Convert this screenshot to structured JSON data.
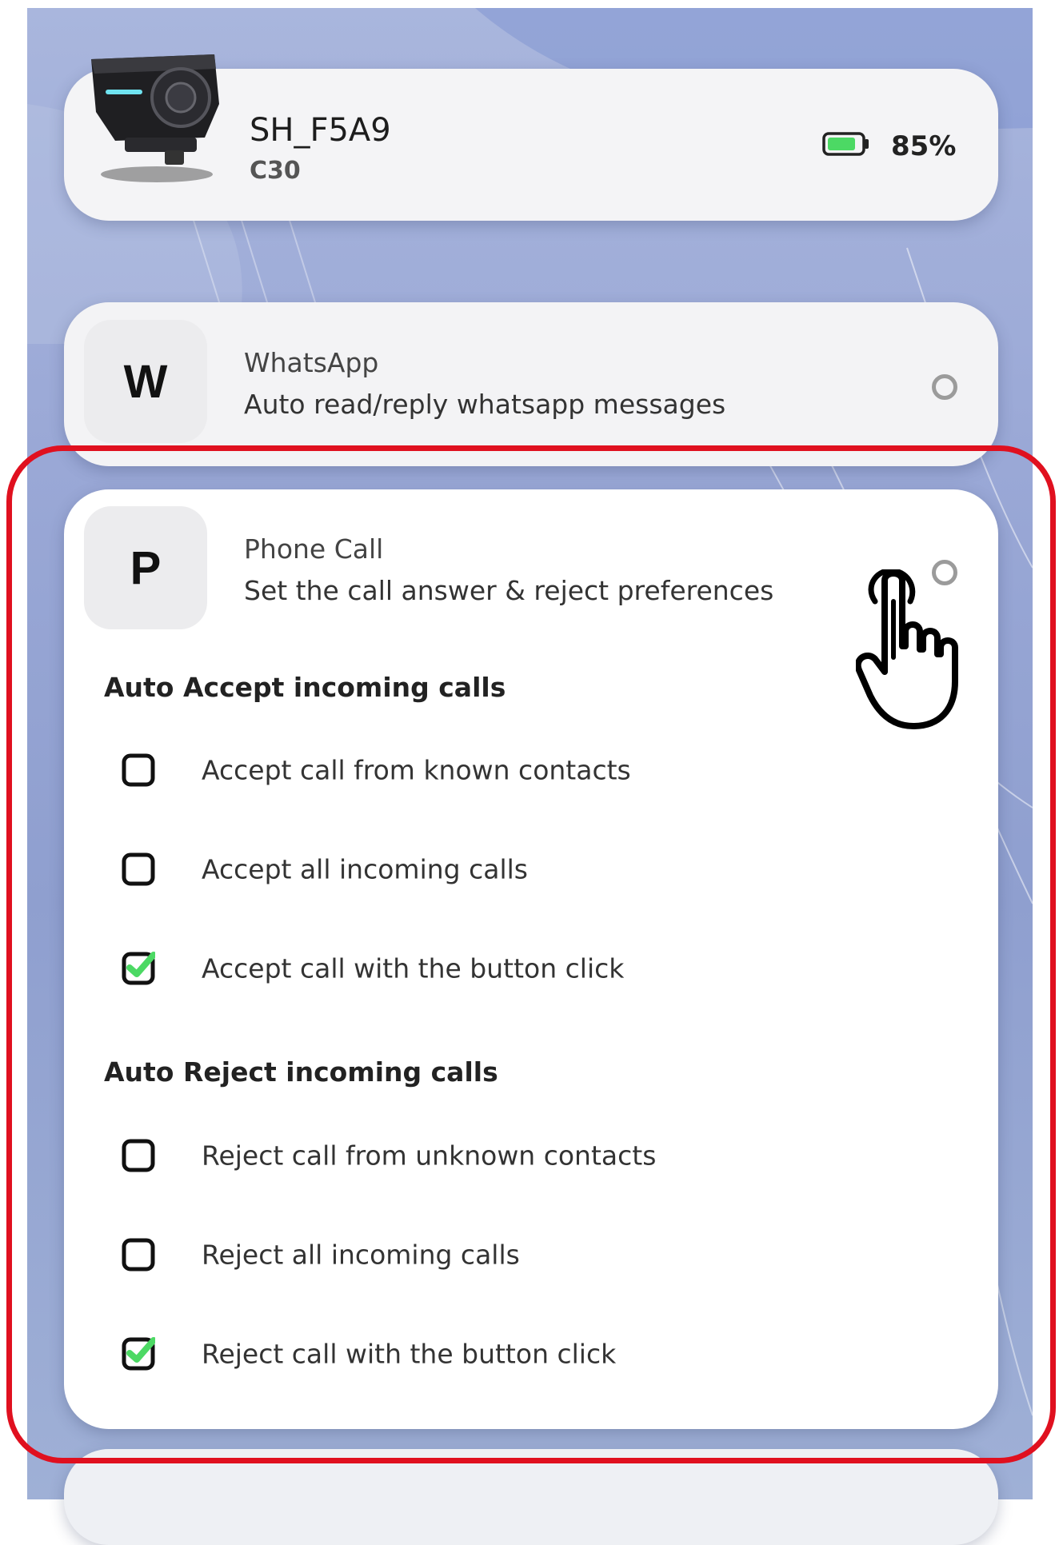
{
  "device": {
    "name": "SH_F5A9",
    "model": "C30",
    "battery_text": "85%",
    "battery_level": 0.85,
    "battery_color": "#4cd964"
  },
  "whatsapp": {
    "avatar_letter": "W",
    "title": "WhatsApp",
    "description": "Auto read/reply whatsapp messages",
    "selected": false
  },
  "phone_call": {
    "avatar_letter": "P",
    "title": "Phone Call",
    "description": "Set the call answer & reject preferences",
    "selected": false,
    "sections": [
      {
        "title": "Auto Accept incoming calls",
        "options": [
          {
            "label": "Accept call from known contacts",
            "checked": false
          },
          {
            "label": "Accept all incoming calls",
            "checked": false
          },
          {
            "label": "Accept call with the button click",
            "checked": true
          }
        ]
      },
      {
        "title": "Auto Reject incoming calls",
        "options": [
          {
            "label": "Reject call from unknown contacts",
            "checked": false
          },
          {
            "label": "Reject all incoming calls",
            "checked": false
          },
          {
            "label": "Reject call with the button click",
            "checked": true
          }
        ]
      }
    ]
  },
  "colors": {
    "highlight": "#e0101f",
    "check": "#4cd964",
    "background": "#9aa8d6"
  },
  "icons": {
    "pointer": "hand-pointer-icon",
    "device": "headset-device-icon",
    "battery": "battery-icon"
  }
}
